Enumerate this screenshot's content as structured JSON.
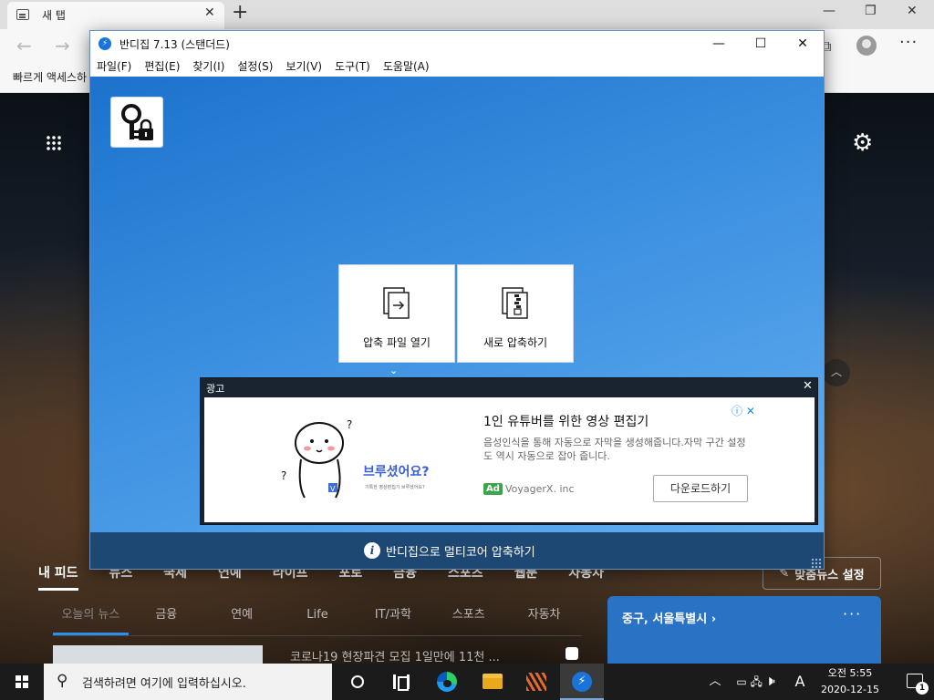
{
  "browser": {
    "tab_title": "새 탭",
    "tab_close": "✕",
    "new_tab": "+",
    "nav_back": "←",
    "nav_forward": "→",
    "favorites_label": "빠르게 액세스하",
    "more": "···",
    "window_minimize": "—",
    "window_restore": "❐",
    "window_close": "✕"
  },
  "page": {
    "feed_nav": [
      "내 피드",
      "뉴스",
      "국제",
      "연예",
      "라이프",
      "포토",
      "금융",
      "스포츠",
      "웹툰",
      "자동차"
    ],
    "feed_settings_label": "맞춤뉴스 설정",
    "feed_settings_icon": "✎",
    "subtabs": [
      "오늘의 뉴스",
      "금융",
      "연예",
      "Life",
      "IT/과학",
      "스포츠",
      "자동차"
    ],
    "news_headline": "코로나19 현장파견 모집 1일만에 11천 ...",
    "weather_location": "중구, 서울특별시  ›",
    "weather_more": "···",
    "scroll_up": "︿"
  },
  "bandizip": {
    "title": "반디집 7.13 (스탠더드)",
    "app_icon": "⚡",
    "controls": {
      "minimize": "—",
      "maximize": "☐",
      "close": "✕"
    },
    "menu": [
      "파일(F)",
      "편집(E)",
      "찾기(I)",
      "설정(S)",
      "보기(V)",
      "도구(T)",
      "도움말(A)"
    ],
    "actions": [
      {
        "label": "압축 파일 열기",
        "icon": "open-archive"
      },
      {
        "label": "새로 압축하기",
        "icon": "new-archive"
      }
    ],
    "expand_icon": "⌄",
    "ad": {
      "label": "광고",
      "close": "✕",
      "info": "ⓘ ✕",
      "title": "1인 유튜버를 위한 영상 편집기",
      "description": "음성인식을 통해 자동으로 자막을 생성해줍니다.자막 구간 설정도 역시 자동으로 잡아 줍니다.",
      "badge": "Ad",
      "advertiser": "VoyagerX. inc",
      "cta": "다운로드하기",
      "illustration_caption": "브루셨어요?",
      "illustration_sub": "기특한 영상편집기 브루셨어요?",
      "illustration_tag": "V"
    },
    "status_icon": "i",
    "status_text": "반디집으로 멀티코어 압축하기"
  },
  "taskbar": {
    "search_icon": "⚲",
    "search_placeholder": "검색하려면 여기에 입력하십시오.",
    "bandizip_glyph": "⚡",
    "tray_chevron": "︿",
    "tray_icons": "▭ 🖧 🕨",
    "ime": "A",
    "clock_time": "오전 5:55",
    "clock_date": "2020-12-15",
    "notification_count": "1"
  }
}
